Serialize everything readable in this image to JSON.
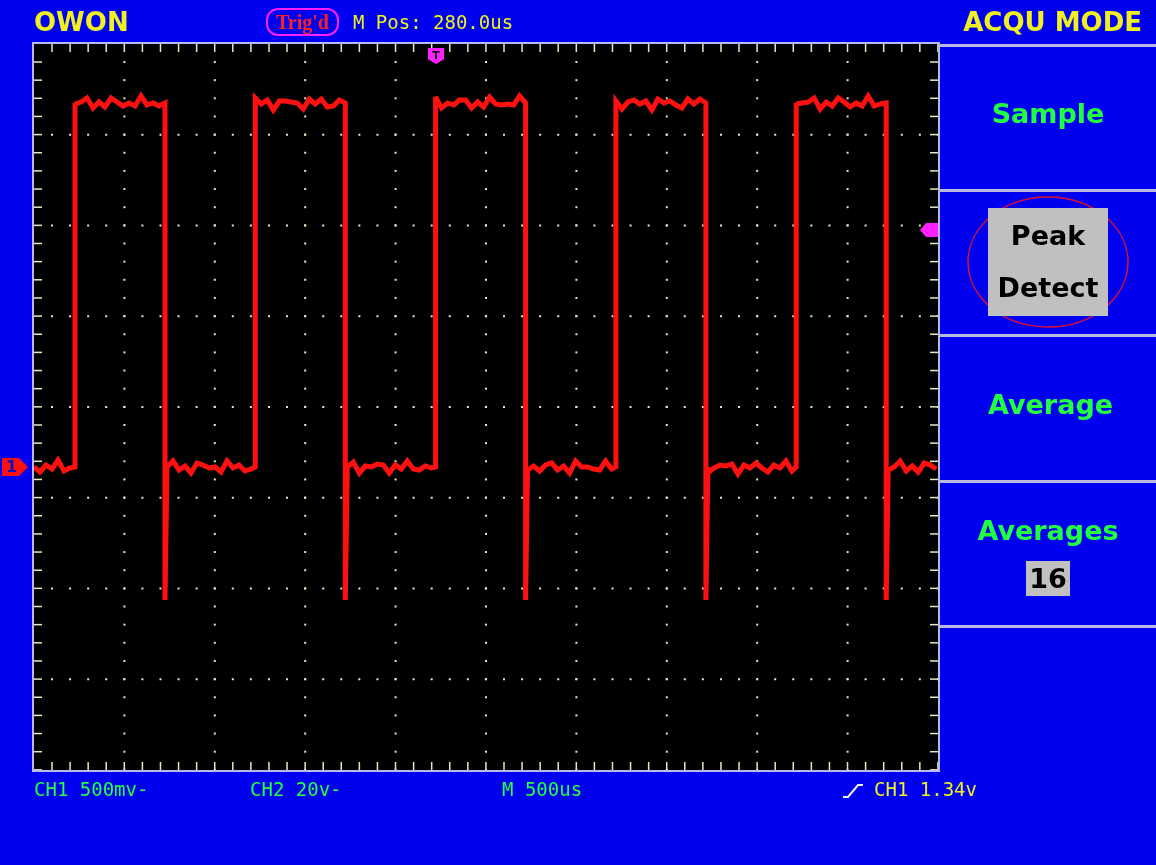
{
  "header": {
    "brand": "OWON",
    "trigger_status": "Trig'd",
    "position": "M Pos: 280.0us",
    "menu_title": "ACQU MODE"
  },
  "display": {
    "trigger_position_marker": "T",
    "channel_marker": "1"
  },
  "menu": [
    {
      "kind": "option",
      "label": "Sample",
      "selected": false
    },
    {
      "kind": "option",
      "label": "Peak Detect",
      "selected": true
    },
    {
      "kind": "option",
      "label": "Average",
      "selected": false
    },
    {
      "kind": "value",
      "label": "Averages",
      "value": "16"
    }
  ],
  "status_bar": {
    "ch1_scale": "CH1 500mv-",
    "ch2_scale": "CH2 20v-",
    "timebase": "M 500us",
    "trigger": "CH1 1.34v"
  }
}
